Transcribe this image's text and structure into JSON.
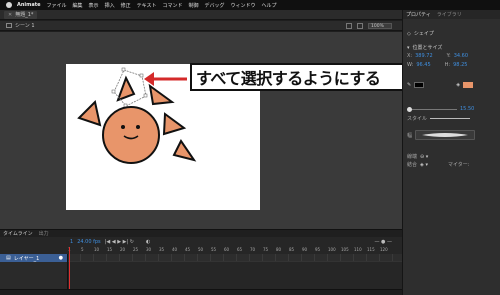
{
  "menubar": {
    "app": "Animate",
    "items": [
      "ファイル",
      "編集",
      "表示",
      "挿入",
      "修正",
      "テキスト",
      "コマンド",
      "制御",
      "デバッグ",
      "ウィンドウ",
      "ヘルプ"
    ]
  },
  "document": {
    "tab_title": "無題_1*",
    "scene": "シーン 1",
    "zoom": "100%"
  },
  "callout": {
    "text": "すべて選択するようにする"
  },
  "properties": {
    "tabs": [
      "プロパティ",
      "ライブラリ"
    ],
    "object_type": "シェイプ",
    "position_section": "位置とサイズ",
    "x_label": "X:",
    "x_value": "389.72",
    "y_label": "Y:",
    "y_value": "34.60",
    "w_label": "W:",
    "w_value": "96.45",
    "h_label": "H:",
    "h_value": "98.25",
    "stroke_width": "15.50",
    "style_label": "スタイル",
    "width_label": "幅",
    "cap_label": "線端",
    "join_label": "結合",
    "miter_label": "マイター:",
    "fill_color": "#e8956a",
    "stroke_color": "#000000"
  },
  "timeline": {
    "tabs": [
      "タイムライン",
      "出力"
    ],
    "fps": "24.00 fps",
    "frame_counter": "1",
    "layer_name": "レイヤー_1",
    "ruler": [
      "1",
      "5",
      "10",
      "15",
      "20",
      "25",
      "30",
      "35",
      "40",
      "45",
      "50",
      "55",
      "60",
      "65",
      "70",
      "75",
      "80",
      "85",
      "90",
      "95",
      "100",
      "105",
      "110",
      "115",
      "120"
    ]
  },
  "colors": {
    "accent": "#3f8fe0",
    "shape_fill": "#e8956a",
    "arrow": "#d42a2a",
    "layer_highlight": "#3b5f95"
  }
}
